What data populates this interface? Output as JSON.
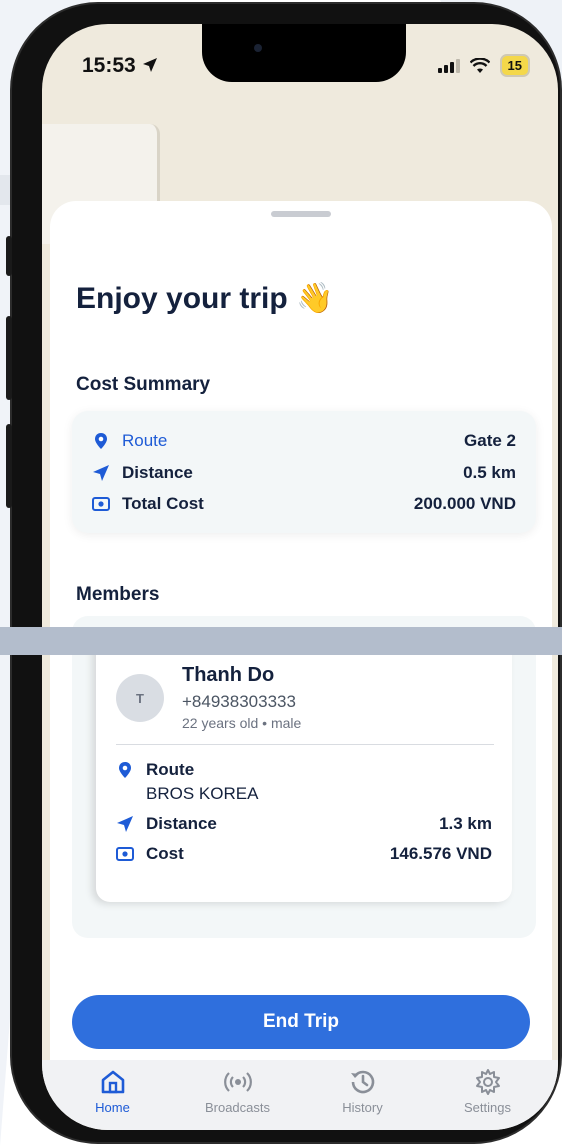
{
  "status_bar": {
    "time": "15:53",
    "battery": "15"
  },
  "sheet": {
    "title": "Enjoy your trip",
    "title_emoji": "👋"
  },
  "cost_summary": {
    "heading": "Cost Summary",
    "route_label": "Route",
    "route_value": "Gate 2",
    "distance_label": "Distance",
    "distance_value": "0.5 km",
    "total_label": "Total Cost",
    "total_value": "200.000 VND"
  },
  "members": {
    "heading": "Members",
    "items": [
      {
        "initial": "T",
        "name": "Thanh Do",
        "phone": "+84938303333",
        "meta": "22 years old • male",
        "route_label": "Route",
        "route_value": "BROS KOREA",
        "distance_label": "Distance",
        "distance_value": "1.3 km",
        "cost_label": "Cost",
        "cost_value": "146.576 VND"
      }
    ]
  },
  "actions": {
    "end_trip": "End Trip"
  },
  "tabbar": {
    "items": [
      {
        "label": "Home",
        "icon": "home-icon",
        "active": true
      },
      {
        "label": "Broadcasts",
        "icon": "broadcast-icon",
        "active": false
      },
      {
        "label": "History",
        "icon": "history-icon",
        "active": false
      },
      {
        "label": "Settings",
        "icon": "gear-icon",
        "active": false
      }
    ]
  },
  "colors": {
    "accent": "#2f6fdd",
    "text_dark": "#14213d",
    "link_blue": "#1e5bd6"
  }
}
